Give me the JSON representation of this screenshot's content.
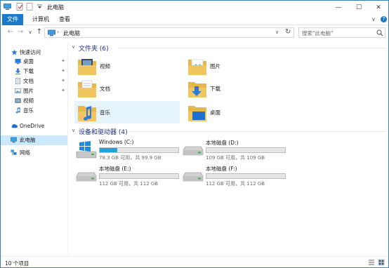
{
  "titlebar": {
    "title": "此电脑",
    "buttons": {
      "minimize": "—",
      "maximize": "☐",
      "close": "✕"
    }
  },
  "ribbon": {
    "tabs": [
      {
        "label": "文件",
        "active": true
      },
      {
        "label": "计算机",
        "active": false
      },
      {
        "label": "查看",
        "active": false
      }
    ],
    "collapse_glyph": "∨",
    "help_glyph": "?"
  },
  "navigation": {
    "back": "←",
    "forward": "→",
    "recent": "∨",
    "up": "↑",
    "breadcrumb": [
      "此电脑"
    ],
    "refresh": "↻",
    "search_placeholder": "搜索\"此电脑\""
  },
  "sidebar": {
    "items": [
      {
        "label": "快速访问",
        "icon": "star-icon"
      },
      {
        "label": "桌面",
        "icon": "desktop-icon",
        "pinned": true
      },
      {
        "label": "下载",
        "icon": "download-icon",
        "pinned": true
      },
      {
        "label": "文档",
        "icon": "documents-icon",
        "pinned": true
      },
      {
        "label": "图片",
        "icon": "pictures-icon",
        "pinned": true
      },
      {
        "label": "视频",
        "icon": "videos-icon"
      },
      {
        "label": "音乐",
        "icon": "music-icon"
      },
      {
        "label": "OneDrive",
        "icon": "cloud-icon"
      },
      {
        "label": "此电脑",
        "icon": "computer-icon",
        "selected": true
      },
      {
        "label": "网络",
        "icon": "network-icon"
      }
    ],
    "pin_glyph": "✦"
  },
  "main": {
    "folders_header": "文件夹 (6)",
    "folders": [
      {
        "name": "视频",
        "icon": "videos-folder-icon"
      },
      {
        "name": "图片",
        "icon": "pictures-folder-icon"
      },
      {
        "name": "文档",
        "icon": "documents-folder-icon"
      },
      {
        "name": "下载",
        "icon": "downloads-folder-icon"
      },
      {
        "name": "音乐",
        "icon": "music-folder-icon"
      },
      {
        "name": "桌面",
        "icon": "desktop-folder-icon"
      }
    ],
    "drives_header": "设备和驱动器 (4)",
    "drives": [
      {
        "name": "Windows (C:)",
        "size": "78.3 GB 可用，共 99.9 GB",
        "used_fraction": 0.22,
        "icon": "windows-drive-icon"
      },
      {
        "name": "本地磁盘 (D:)",
        "size": "109 GB 可用，共 109 GB",
        "used_fraction": 0.0,
        "icon": "hard-drive-icon"
      },
      {
        "name": "本地磁盘 (E:)",
        "size": "112 GB 可用，共 112 GB",
        "used_fraction": 0.0,
        "icon": "hard-drive-icon"
      },
      {
        "name": "本地磁盘 (F:)",
        "size": "112 GB 可用，共 112 GB",
        "used_fraction": 0.0,
        "icon": "hard-drive-icon"
      }
    ]
  },
  "statusbar": {
    "count": "10 个项目"
  },
  "colors": {
    "accent": "#1979ca",
    "selection": "#cce8ff",
    "hover": "#e5f3fb",
    "drive_fill": "#26a0da",
    "folder": "#f1c660",
    "header_text": "#1e3287"
  }
}
